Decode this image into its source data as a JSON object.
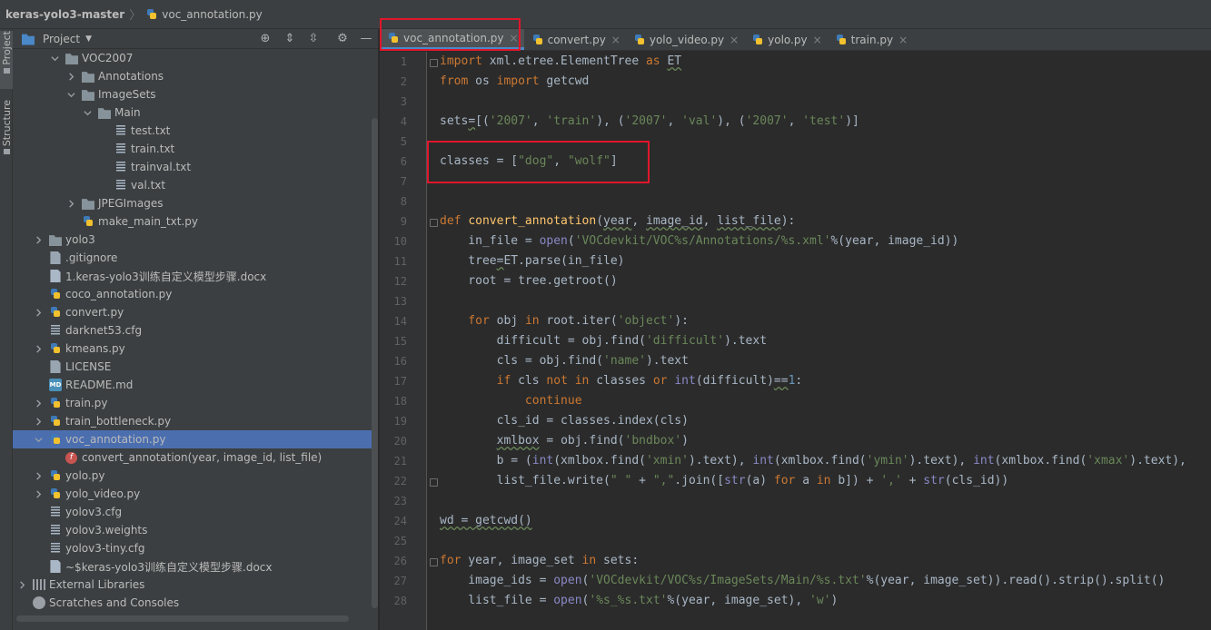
{
  "breadcrumb": {
    "project": "keras-yolo3-master",
    "file": "voc_annotation.py"
  },
  "tool_strip": {
    "project_tab": "Project",
    "structure_tab": "Structure"
  },
  "project_panel": {
    "title": "Project",
    "tree": [
      {
        "label": "VOC2007",
        "kind": "folder",
        "indent": 2,
        "expanded": true
      },
      {
        "label": "Annotations",
        "kind": "folder",
        "indent": 3,
        "expanded": false
      },
      {
        "label": "ImageSets",
        "kind": "folder",
        "indent": 3,
        "expanded": true
      },
      {
        "label": "Main",
        "kind": "folder",
        "indent": 4,
        "expanded": true
      },
      {
        "label": "test.txt",
        "kind": "txt",
        "indent": 5
      },
      {
        "label": "train.txt",
        "kind": "txt",
        "indent": 5
      },
      {
        "label": "trainval.txt",
        "kind": "txt",
        "indent": 5
      },
      {
        "label": "val.txt",
        "kind": "txt",
        "indent": 5
      },
      {
        "label": "JPEGImages",
        "kind": "folder",
        "indent": 3,
        "expanded": false
      },
      {
        "label": "make_main_txt.py",
        "kind": "py",
        "indent": 3
      },
      {
        "label": "yolo3",
        "kind": "folder",
        "indent": 1,
        "expanded": false
      },
      {
        "label": ".gitignore",
        "kind": "plain",
        "indent": 1
      },
      {
        "label": "1.keras-yolo3训练自定义模型步骤.docx",
        "kind": "docx",
        "indent": 1
      },
      {
        "label": "coco_annotation.py",
        "kind": "py",
        "indent": 1
      },
      {
        "label": "convert.py",
        "kind": "py",
        "indent": 1,
        "expanded": false
      },
      {
        "label": "darknet53.cfg",
        "kind": "txt",
        "indent": 1
      },
      {
        "label": "kmeans.py",
        "kind": "py",
        "indent": 1,
        "expanded": false
      },
      {
        "label": "LICENSE",
        "kind": "plain",
        "indent": 1
      },
      {
        "label": "README.md",
        "kind": "md",
        "indent": 1
      },
      {
        "label": "train.py",
        "kind": "py",
        "indent": 1,
        "expanded": false
      },
      {
        "label": "train_bottleneck.py",
        "kind": "py",
        "indent": 1,
        "expanded": false
      },
      {
        "label": "voc_annotation.py",
        "kind": "py",
        "indent": 1,
        "expanded": true,
        "selected": true
      },
      {
        "label": "convert_annotation(year, image_id, list_file)",
        "kind": "function",
        "indent": 2
      },
      {
        "label": "yolo.py",
        "kind": "py",
        "indent": 1,
        "expanded": false
      },
      {
        "label": "yolo_video.py",
        "kind": "py",
        "indent": 1,
        "expanded": false
      },
      {
        "label": "yolov3.cfg",
        "kind": "txt",
        "indent": 1
      },
      {
        "label": "yolov3.weights",
        "kind": "txt",
        "indent": 1
      },
      {
        "label": "yolov3-tiny.cfg",
        "kind": "txt",
        "indent": 1
      },
      {
        "label": "~$keras-yolo3训练自定义模型步骤.docx",
        "kind": "docx",
        "indent": 1
      },
      {
        "label": "External Libraries",
        "kind": "libraries",
        "indent": 0,
        "expanded": false
      },
      {
        "label": "Scratches and Consoles",
        "kind": "scratches",
        "indent": 0
      }
    ]
  },
  "tabs": [
    {
      "label": "voc_annotation.py",
      "active": true
    },
    {
      "label": "convert.py",
      "active": false
    },
    {
      "label": "yolo_video.py",
      "active": false
    },
    {
      "label": "yolo.py",
      "active": false
    },
    {
      "label": "train.py",
      "active": false
    }
  ],
  "editor": {
    "lines": [
      {
        "n": "1",
        "tokens": [
          [
            "kw",
            "import"
          ],
          [
            "p",
            " xml.etree.ElementTree "
          ],
          [
            "kw",
            "as"
          ],
          [
            "p",
            " "
          ],
          [
            "sq",
            "ET"
          ]
        ]
      },
      {
        "n": "2",
        "tokens": [
          [
            "kw",
            "from"
          ],
          [
            "p",
            " os "
          ],
          [
            "kw",
            "import"
          ],
          [
            "p",
            " getcwd"
          ]
        ]
      },
      {
        "n": "3",
        "tokens": []
      },
      {
        "n": "4",
        "tokens": [
          [
            "p",
            "sets"
          ],
          [
            "sq",
            "="
          ],
          [
            "p",
            "[("
          ],
          [
            "str",
            "'2007'"
          ],
          [
            "p",
            ", "
          ],
          [
            "str",
            "'train'"
          ],
          [
            "p",
            "), ("
          ],
          [
            "str",
            "'2007'"
          ],
          [
            "p",
            ", "
          ],
          [
            "str",
            "'val'"
          ],
          [
            "p",
            "), ("
          ],
          [
            "str",
            "'2007'"
          ],
          [
            "p",
            ", "
          ],
          [
            "str",
            "'test'"
          ],
          [
            "p",
            ")]"
          ]
        ]
      },
      {
        "n": "5",
        "tokens": []
      },
      {
        "n": "6",
        "tokens": [
          [
            "p",
            "classes = ["
          ],
          [
            "str",
            "\"dog\""
          ],
          [
            "p",
            ", "
          ],
          [
            "str",
            "\"wolf\""
          ],
          [
            "p",
            "]"
          ]
        ]
      },
      {
        "n": "7",
        "tokens": []
      },
      {
        "n": "8",
        "tokens": []
      },
      {
        "n": "9",
        "tokens": [
          [
            "kw",
            "def "
          ],
          [
            "fn",
            "convert_annotation"
          ],
          [
            "p",
            "("
          ],
          [
            "sq",
            "year"
          ],
          [
            "p",
            ", "
          ],
          [
            "sq",
            "image_id"
          ],
          [
            "p",
            ", "
          ],
          [
            "sq",
            "list_file"
          ],
          [
            "p",
            "):"
          ]
        ]
      },
      {
        "n": "10",
        "tokens": [
          [
            "p",
            "    in_file = "
          ],
          [
            "bi",
            "open"
          ],
          [
            "p",
            "("
          ],
          [
            "str",
            "'VOCdevkit/VOC%s/Annotations/%s.xml'"
          ],
          [
            "p",
            "%(year, image_id))"
          ]
        ]
      },
      {
        "n": "11",
        "tokens": [
          [
            "p",
            "    tree"
          ],
          [
            "sq",
            "="
          ],
          [
            "p",
            "ET.parse(in_file)"
          ]
        ]
      },
      {
        "n": "12",
        "tokens": [
          [
            "p",
            "    root = tree.getroot()"
          ]
        ]
      },
      {
        "n": "13",
        "tokens": []
      },
      {
        "n": "14",
        "tokens": [
          [
            "kw",
            "    for"
          ],
          [
            "p",
            " obj "
          ],
          [
            "kw",
            "in"
          ],
          [
            "p",
            " root.iter("
          ],
          [
            "str",
            "'object'"
          ],
          [
            "p",
            "):"
          ]
        ]
      },
      {
        "n": "15",
        "tokens": [
          [
            "p",
            "        difficult = obj.find("
          ],
          [
            "str",
            "'difficult'"
          ],
          [
            "p",
            ").text"
          ]
        ]
      },
      {
        "n": "16",
        "tokens": [
          [
            "p",
            "        cls = obj.find("
          ],
          [
            "str",
            "'name'"
          ],
          [
            "p",
            ").text"
          ]
        ]
      },
      {
        "n": "17",
        "tokens": [
          [
            "kw",
            "        if"
          ],
          [
            "p",
            " cls "
          ],
          [
            "kw",
            "not in"
          ],
          [
            "p",
            " classes "
          ],
          [
            "kw",
            "or "
          ],
          [
            "bi",
            "int"
          ],
          [
            "p",
            "(difficult)"
          ],
          [
            "sq",
            "=="
          ],
          [
            "num",
            "1"
          ],
          [
            "p",
            ":"
          ]
        ]
      },
      {
        "n": "18",
        "tokens": [
          [
            "kw",
            "            continue"
          ]
        ]
      },
      {
        "n": "19",
        "tokens": [
          [
            "p",
            "        cls_id = classes.index(cls)"
          ]
        ]
      },
      {
        "n": "20",
        "tokens": [
          [
            "p",
            "        "
          ],
          [
            "sq",
            "xmlbox"
          ],
          [
            "p",
            " = obj.find("
          ],
          [
            "str",
            "'bndbox'"
          ],
          [
            "p",
            ")"
          ]
        ]
      },
      {
        "n": "21",
        "tokens": [
          [
            "p",
            "        b = ("
          ],
          [
            "bi",
            "int"
          ],
          [
            "p",
            "(xmlbox.find("
          ],
          [
            "str",
            "'xmin'"
          ],
          [
            "p",
            ").text), "
          ],
          [
            "bi",
            "int"
          ],
          [
            "p",
            "(xmlbox.find("
          ],
          [
            "str",
            "'ymin'"
          ],
          [
            "p",
            ").text), "
          ],
          [
            "bi",
            "int"
          ],
          [
            "p",
            "(xmlbox.find("
          ],
          [
            "str",
            "'xmax'"
          ],
          [
            "p",
            ").text),"
          ]
        ]
      },
      {
        "n": "22",
        "tokens": [
          [
            "p",
            "        list_file.write("
          ],
          [
            "str",
            "\" \""
          ],
          [
            "p",
            " + "
          ],
          [
            "str",
            "\",\""
          ],
          [
            "p",
            ".join(["
          ],
          [
            "bi",
            "str"
          ],
          [
            "p",
            "(a) "
          ],
          [
            "kw",
            "for"
          ],
          [
            "p",
            " a "
          ],
          [
            "kw",
            "in"
          ],
          [
            "p",
            " b]) + "
          ],
          [
            "str",
            "','"
          ],
          [
            "p",
            " + "
          ],
          [
            "bi",
            "str"
          ],
          [
            "p",
            "(cls_id))"
          ]
        ]
      },
      {
        "n": "23",
        "tokens": []
      },
      {
        "n": "24",
        "tokens": [
          [
            "sq",
            "wd = getcwd()"
          ]
        ]
      },
      {
        "n": "25",
        "tokens": []
      },
      {
        "n": "26",
        "tokens": [
          [
            "kw",
            "for"
          ],
          [
            "p",
            " year, image_set "
          ],
          [
            "kw",
            "in"
          ],
          [
            "p",
            " sets:"
          ]
        ]
      },
      {
        "n": "27",
        "tokens": [
          [
            "p",
            "    image_ids = "
          ],
          [
            "bi",
            "open"
          ],
          [
            "p",
            "("
          ],
          [
            "str",
            "'VOCdevkit/VOC%s/ImageSets/Main/%s.txt'"
          ],
          [
            "p",
            "%(year, image_set)).read().strip().split()"
          ]
        ]
      },
      {
        "n": "28",
        "tokens": [
          [
            "p",
            "    list_file = "
          ],
          [
            "bi",
            "open"
          ],
          [
            "p",
            "("
          ],
          [
            "str",
            "'%s_%s.txt'"
          ],
          [
            "p",
            "%(year, image_set), "
          ],
          [
            "str",
            "'w'"
          ],
          [
            "p",
            ")"
          ]
        ]
      }
    ]
  },
  "colors": {
    "highlight_box": "#e0162b",
    "selection": "#4b6eaf",
    "tab_underline": "#4a88c7"
  }
}
